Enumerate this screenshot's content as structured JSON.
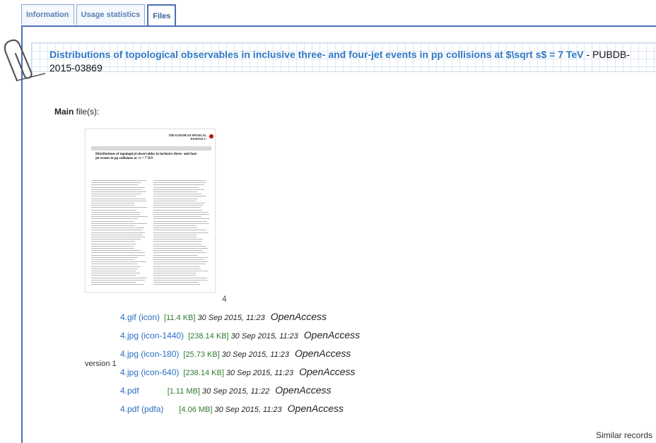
{
  "tabs": [
    {
      "label": "Information",
      "active": false
    },
    {
      "label": "Usage statistics",
      "active": false
    },
    {
      "label": "Files",
      "active": true
    }
  ],
  "record": {
    "title_link": "Distributions of topological observables in inclusive three- and four-jet events in pp collisions at $\\sqrt s$ = 7 TeV",
    "title_suffix": " - PUBDB-2015-03869"
  },
  "main_files": {
    "label_bold": "Main",
    "label_rest": " file(s):"
  },
  "thumbnail": {
    "journal_name": "THE EUROPEAN PHYSICAL JOURNAL C",
    "paper_title": "Distributions of topological observables in inclusive three- and four-jet events in pp collisions at √s = 7 TeV",
    "caption": "4"
  },
  "version_label": "version 1",
  "files": [
    {
      "name": "4.gif (icon)",
      "size": "[11.4 KB]",
      "date": "30 Sep 2015, 11:23",
      "access": "OpenAccess"
    },
    {
      "name": "4.jpg (icon-1440)",
      "size": "[238.14 KB]",
      "date": "30 Sep 2015, 11:23",
      "access": "OpenAccess"
    },
    {
      "name": "4.jpg (icon-180)",
      "size": "[25.73 KB]",
      "date": "30 Sep 2015, 11:23",
      "access": "OpenAccess"
    },
    {
      "name": "4.jpg (icon-640)",
      "size": "[238.14 KB]",
      "date": "30 Sep 2015, 11:23",
      "access": "OpenAccess"
    },
    {
      "name": "4.pdf",
      "size": "[1.11 MB]",
      "date": "30 Sep 2015, 11:22",
      "access": "OpenAccess"
    },
    {
      "name": "4.pdf (pdfa)",
      "size": "[4.06 MB]",
      "date": "30 Sep 2015, 11:23",
      "access": "OpenAccess"
    }
  ],
  "footer": {
    "similar_records": "Similar records"
  },
  "colors": {
    "accent": "#4a70b8",
    "link": "#2b6fc2",
    "size_text": "#2f7a2f"
  },
  "icons": {
    "paperclip": "paperclip-icon"
  }
}
